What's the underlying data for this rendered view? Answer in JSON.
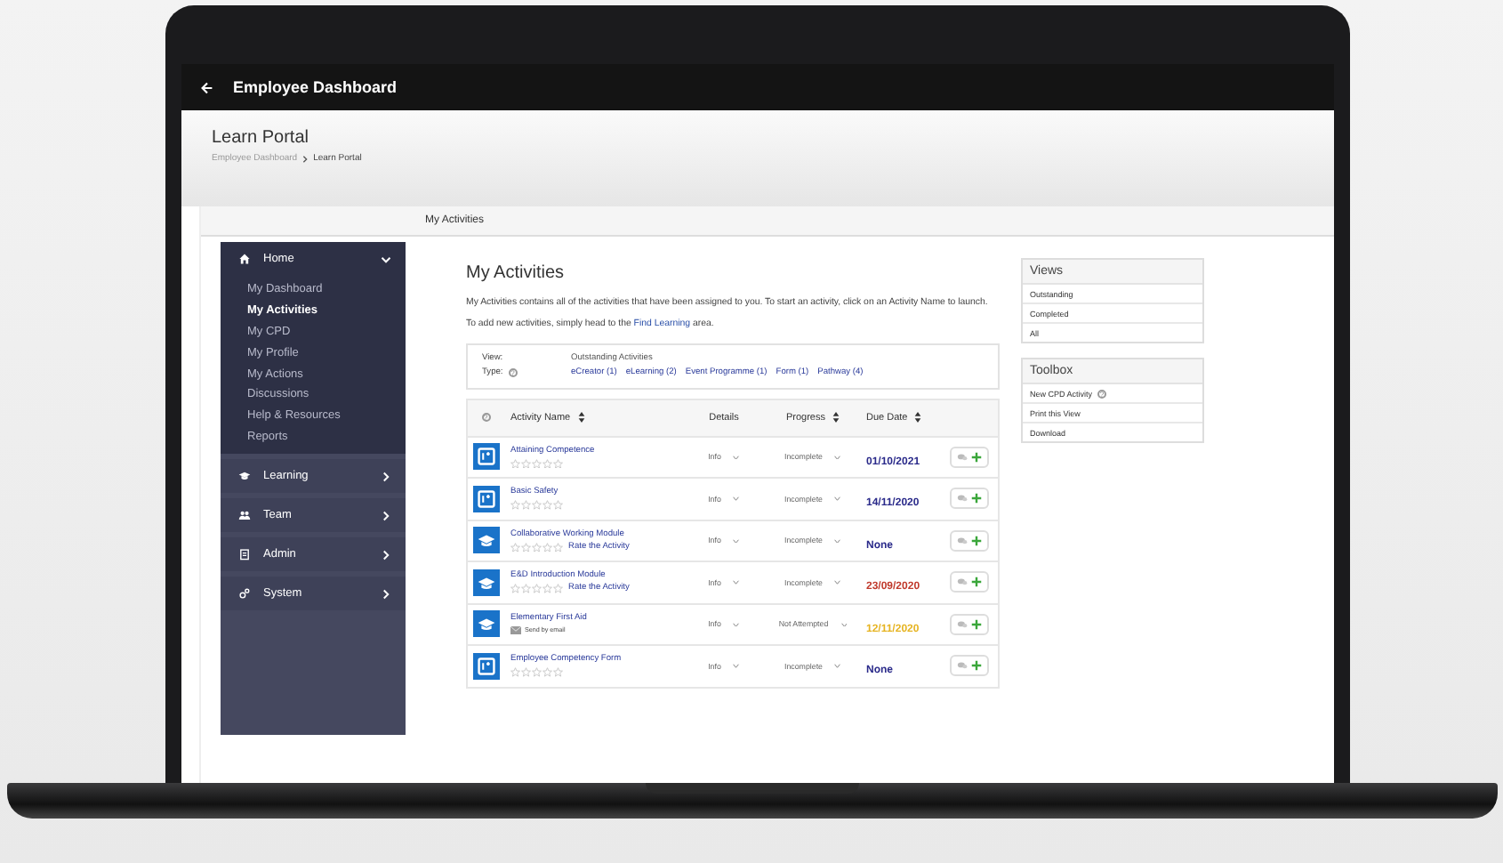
{
  "app_bar": {
    "title": "Employee Dashboard"
  },
  "header": {
    "title": "Learn Portal",
    "breadcrumb": [
      "Employee Dashboard",
      "Learn Portal"
    ]
  },
  "tab_bar": {
    "label": "My Activities"
  },
  "sidebar": {
    "sections": [
      {
        "label": "Home",
        "kind": "home",
        "expanded": true,
        "children": [
          {
            "label": "My Dashboard",
            "selected": false
          },
          {
            "label": "My Activities",
            "selected": true
          },
          {
            "label": "My CPD",
            "selected": false
          },
          {
            "label": "My Profile",
            "selected": false
          },
          {
            "label": "My Actions",
            "selected": false
          },
          {
            "label": "Discussions",
            "selected": false
          },
          {
            "label": "Help & Resources",
            "selected": false
          },
          {
            "label": "Reports",
            "selected": false
          }
        ]
      },
      {
        "label": "Learning",
        "kind": "learning",
        "expanded": false
      },
      {
        "label": "Team",
        "kind": "team",
        "expanded": false
      },
      {
        "label": "Admin",
        "kind": "admin",
        "expanded": false
      },
      {
        "label": "System",
        "kind": "system",
        "expanded": false
      }
    ]
  },
  "main": {
    "title": "My Activities",
    "intro": "My Activities contains all of the activities that have been assigned to you. To start an activity, click on an Activity Name to launch.",
    "add_text_before": "To add new activities, simply head to the",
    "add_link": "Find Learning",
    "add_text_after": "area.",
    "filter": {
      "view_label": "View:",
      "view_value": "Outstanding Activities",
      "type_label": "Type:",
      "type_help": "?",
      "types": [
        "eCreator (1)",
        "eLearning (2)",
        "Event Programme (1)",
        "Form (1)",
        "Pathway (4)"
      ]
    },
    "table": {
      "help": "?",
      "columns": [
        "Activity Name",
        "Details",
        "Progress",
        "Due Date"
      ],
      "rows": [
        {
          "kind": "form",
          "name": "Attaining Competence",
          "stars": 0,
          "details": "Info",
          "progress": "Incomplete",
          "due": "01/10/2021",
          "color": "#2a2a8a"
        },
        {
          "kind": "form",
          "name": "Basic Safety",
          "stars": 0,
          "details": "Info",
          "progress": "Incomplete",
          "due": "14/11/2020",
          "color": "#2a2a8a"
        },
        {
          "kind": "course",
          "name": "Collaborative Working Module",
          "stars": 0,
          "rate_link": "Rate the Activity",
          "details": "Info",
          "progress": "Incomplete",
          "due": "None",
          "color": "#2a2a8a"
        },
        {
          "kind": "course",
          "name": "E&D Introduction Module",
          "stars": 0,
          "rate_link": "Rate the Activity",
          "details": "Info",
          "progress": "Incomplete",
          "due": "23/09/2020",
          "color": "#c0392b"
        },
        {
          "kind": "course",
          "name": "Elementary First Aid",
          "email": "Send by email",
          "details": "Info",
          "progress": "Not Attempted",
          "due": "12/11/2020",
          "color": "#e6b422"
        },
        {
          "kind": "form",
          "name": "Employee Competency Form",
          "stars": 0,
          "details": "Info",
          "progress": "Incomplete",
          "due": "None",
          "color": "#2a2a8a"
        }
      ]
    }
  },
  "views": {
    "title": "Views",
    "items": [
      "Outstanding",
      "Completed",
      "All"
    ]
  },
  "toolbox": {
    "title": "Toolbox",
    "items": [
      {
        "label": "New CPD Activity",
        "help": "?"
      },
      {
        "label": "Print this View"
      },
      {
        "label": "Download"
      }
    ]
  }
}
